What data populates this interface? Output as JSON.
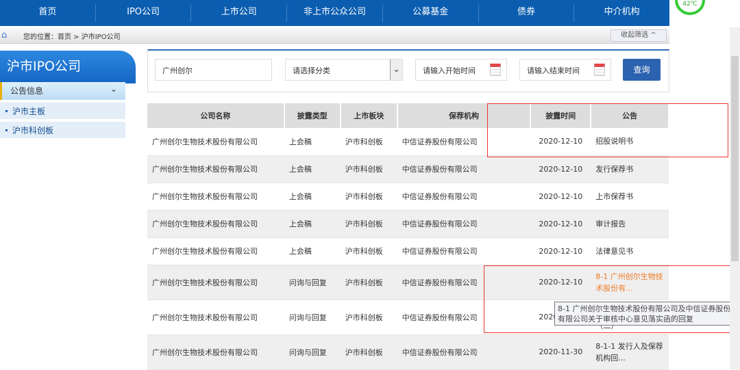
{
  "nav": [
    "首页",
    "IPO公司",
    "上市公司",
    "非上市公众公司",
    "公募基金",
    "债券",
    "中介机构"
  ],
  "badge": "42℃",
  "breadcrumb": {
    "label": "您的位置：首页 > 沪市IPO公司",
    "collapse": "收起筛选 ^"
  },
  "sidebar": {
    "title": "沪市IPO公司",
    "section": "公告信息",
    "items": [
      "沪市主板",
      "沪市科创板"
    ]
  },
  "search": {
    "company": "广州创尔",
    "category": "请选择分类",
    "start": "请输入开始时间",
    "end": "请输入结束时间",
    "button": "查询"
  },
  "table": {
    "headers": [
      "公司名称",
      "披露类型",
      "上市板块",
      "保荐机构",
      "披露时间",
      "公告"
    ],
    "rows": [
      [
        "广州创尔生物技术股份有限公司",
        "上会稿",
        "沪市科创板",
        "中信证券股份有限公司",
        "2020-12-10",
        "招股说明书"
      ],
      [
        "广州创尔生物技术股份有限公司",
        "上会稿",
        "沪市科创板",
        "中信证券股份有限公司",
        "2020-12-10",
        "发行保荐书"
      ],
      [
        "广州创尔生物技术股份有限公司",
        "上会稿",
        "沪市科创板",
        "中信证券股份有限公司",
        "2020-12-10",
        "上市保荐书"
      ],
      [
        "广州创尔生物技术股份有限公司",
        "上会稿",
        "沪市科创板",
        "中信证券股份有限公司",
        "2020-12-10",
        "审计报告"
      ],
      [
        "广州创尔生物技术股份有限公司",
        "上会稿",
        "沪市科创板",
        "中信证券股份有限公司",
        "2020-12-10",
        "法律意见书"
      ],
      [
        "广州创尔生物技术股份有限公司",
        "问询与回复",
        "沪市科创板",
        "中信证券股份有限公司",
        "2020-12-10",
        "8-1 广州创尔生物技术股份有..."
      ],
      [
        "广州创尔生物技术股份有限公司",
        "问询与回复",
        "沪市科创板",
        "中信证券股份有限公司",
        "2020-12-10",
        "（二）"
      ],
      [
        "广州创尔生物技术股份有限公司",
        "问询与回复",
        "沪市科创板",
        "中信证券股份有限公司",
        "2020-11-30",
        "8-1-1 发行人及保荐机构回..."
      ]
    ]
  },
  "tooltip": "8-1 广州创尔生物技术股份有限公司及中信证券股份有限公司关于审核中心意见落实函的回复"
}
